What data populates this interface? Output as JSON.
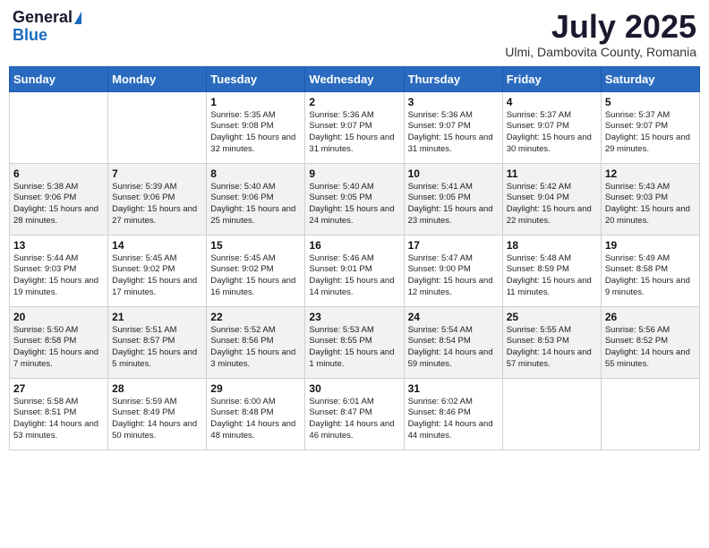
{
  "header": {
    "logo_general": "General",
    "logo_blue": "Blue",
    "month_year": "July 2025",
    "location": "Ulmi, Dambovita County, Romania"
  },
  "weekdays": [
    "Sunday",
    "Monday",
    "Tuesday",
    "Wednesday",
    "Thursday",
    "Friday",
    "Saturday"
  ],
  "weeks": [
    [
      {
        "day": "",
        "sunrise": "",
        "sunset": "",
        "daylight": ""
      },
      {
        "day": "",
        "sunrise": "",
        "sunset": "",
        "daylight": ""
      },
      {
        "day": "1",
        "sunrise": "Sunrise: 5:35 AM",
        "sunset": "Sunset: 9:08 PM",
        "daylight": "Daylight: 15 hours and 32 minutes."
      },
      {
        "day": "2",
        "sunrise": "Sunrise: 5:36 AM",
        "sunset": "Sunset: 9:07 PM",
        "daylight": "Daylight: 15 hours and 31 minutes."
      },
      {
        "day": "3",
        "sunrise": "Sunrise: 5:36 AM",
        "sunset": "Sunset: 9:07 PM",
        "daylight": "Daylight: 15 hours and 31 minutes."
      },
      {
        "day": "4",
        "sunrise": "Sunrise: 5:37 AM",
        "sunset": "Sunset: 9:07 PM",
        "daylight": "Daylight: 15 hours and 30 minutes."
      },
      {
        "day": "5",
        "sunrise": "Sunrise: 5:37 AM",
        "sunset": "Sunset: 9:07 PM",
        "daylight": "Daylight: 15 hours and 29 minutes."
      }
    ],
    [
      {
        "day": "6",
        "sunrise": "Sunrise: 5:38 AM",
        "sunset": "Sunset: 9:06 PM",
        "daylight": "Daylight: 15 hours and 28 minutes."
      },
      {
        "day": "7",
        "sunrise": "Sunrise: 5:39 AM",
        "sunset": "Sunset: 9:06 PM",
        "daylight": "Daylight: 15 hours and 27 minutes."
      },
      {
        "day": "8",
        "sunrise": "Sunrise: 5:40 AM",
        "sunset": "Sunset: 9:06 PM",
        "daylight": "Daylight: 15 hours and 25 minutes."
      },
      {
        "day": "9",
        "sunrise": "Sunrise: 5:40 AM",
        "sunset": "Sunset: 9:05 PM",
        "daylight": "Daylight: 15 hours and 24 minutes."
      },
      {
        "day": "10",
        "sunrise": "Sunrise: 5:41 AM",
        "sunset": "Sunset: 9:05 PM",
        "daylight": "Daylight: 15 hours and 23 minutes."
      },
      {
        "day": "11",
        "sunrise": "Sunrise: 5:42 AM",
        "sunset": "Sunset: 9:04 PM",
        "daylight": "Daylight: 15 hours and 22 minutes."
      },
      {
        "day": "12",
        "sunrise": "Sunrise: 5:43 AM",
        "sunset": "Sunset: 9:03 PM",
        "daylight": "Daylight: 15 hours and 20 minutes."
      }
    ],
    [
      {
        "day": "13",
        "sunrise": "Sunrise: 5:44 AM",
        "sunset": "Sunset: 9:03 PM",
        "daylight": "Daylight: 15 hours and 19 minutes."
      },
      {
        "day": "14",
        "sunrise": "Sunrise: 5:45 AM",
        "sunset": "Sunset: 9:02 PM",
        "daylight": "Daylight: 15 hours and 17 minutes."
      },
      {
        "day": "15",
        "sunrise": "Sunrise: 5:45 AM",
        "sunset": "Sunset: 9:02 PM",
        "daylight": "Daylight: 15 hours and 16 minutes."
      },
      {
        "day": "16",
        "sunrise": "Sunrise: 5:46 AM",
        "sunset": "Sunset: 9:01 PM",
        "daylight": "Daylight: 15 hours and 14 minutes."
      },
      {
        "day": "17",
        "sunrise": "Sunrise: 5:47 AM",
        "sunset": "Sunset: 9:00 PM",
        "daylight": "Daylight: 15 hours and 12 minutes."
      },
      {
        "day": "18",
        "sunrise": "Sunrise: 5:48 AM",
        "sunset": "Sunset: 8:59 PM",
        "daylight": "Daylight: 15 hours and 11 minutes."
      },
      {
        "day": "19",
        "sunrise": "Sunrise: 5:49 AM",
        "sunset": "Sunset: 8:58 PM",
        "daylight": "Daylight: 15 hours and 9 minutes."
      }
    ],
    [
      {
        "day": "20",
        "sunrise": "Sunrise: 5:50 AM",
        "sunset": "Sunset: 8:58 PM",
        "daylight": "Daylight: 15 hours and 7 minutes."
      },
      {
        "day": "21",
        "sunrise": "Sunrise: 5:51 AM",
        "sunset": "Sunset: 8:57 PM",
        "daylight": "Daylight: 15 hours and 5 minutes."
      },
      {
        "day": "22",
        "sunrise": "Sunrise: 5:52 AM",
        "sunset": "Sunset: 8:56 PM",
        "daylight": "Daylight: 15 hours and 3 minutes."
      },
      {
        "day": "23",
        "sunrise": "Sunrise: 5:53 AM",
        "sunset": "Sunset: 8:55 PM",
        "daylight": "Daylight: 15 hours and 1 minute."
      },
      {
        "day": "24",
        "sunrise": "Sunrise: 5:54 AM",
        "sunset": "Sunset: 8:54 PM",
        "daylight": "Daylight: 14 hours and 59 minutes."
      },
      {
        "day": "25",
        "sunrise": "Sunrise: 5:55 AM",
        "sunset": "Sunset: 8:53 PM",
        "daylight": "Daylight: 14 hours and 57 minutes."
      },
      {
        "day": "26",
        "sunrise": "Sunrise: 5:56 AM",
        "sunset": "Sunset: 8:52 PM",
        "daylight": "Daylight: 14 hours and 55 minutes."
      }
    ],
    [
      {
        "day": "27",
        "sunrise": "Sunrise: 5:58 AM",
        "sunset": "Sunset: 8:51 PM",
        "daylight": "Daylight: 14 hours and 53 minutes."
      },
      {
        "day": "28",
        "sunrise": "Sunrise: 5:59 AM",
        "sunset": "Sunset: 8:49 PM",
        "daylight": "Daylight: 14 hours and 50 minutes."
      },
      {
        "day": "29",
        "sunrise": "Sunrise: 6:00 AM",
        "sunset": "Sunset: 8:48 PM",
        "daylight": "Daylight: 14 hours and 48 minutes."
      },
      {
        "day": "30",
        "sunrise": "Sunrise: 6:01 AM",
        "sunset": "Sunset: 8:47 PM",
        "daylight": "Daylight: 14 hours and 46 minutes."
      },
      {
        "day": "31",
        "sunrise": "Sunrise: 6:02 AM",
        "sunset": "Sunset: 8:46 PM",
        "daylight": "Daylight: 14 hours and 44 minutes."
      },
      {
        "day": "",
        "sunrise": "",
        "sunset": "",
        "daylight": ""
      },
      {
        "day": "",
        "sunrise": "",
        "sunset": "",
        "daylight": ""
      }
    ]
  ]
}
